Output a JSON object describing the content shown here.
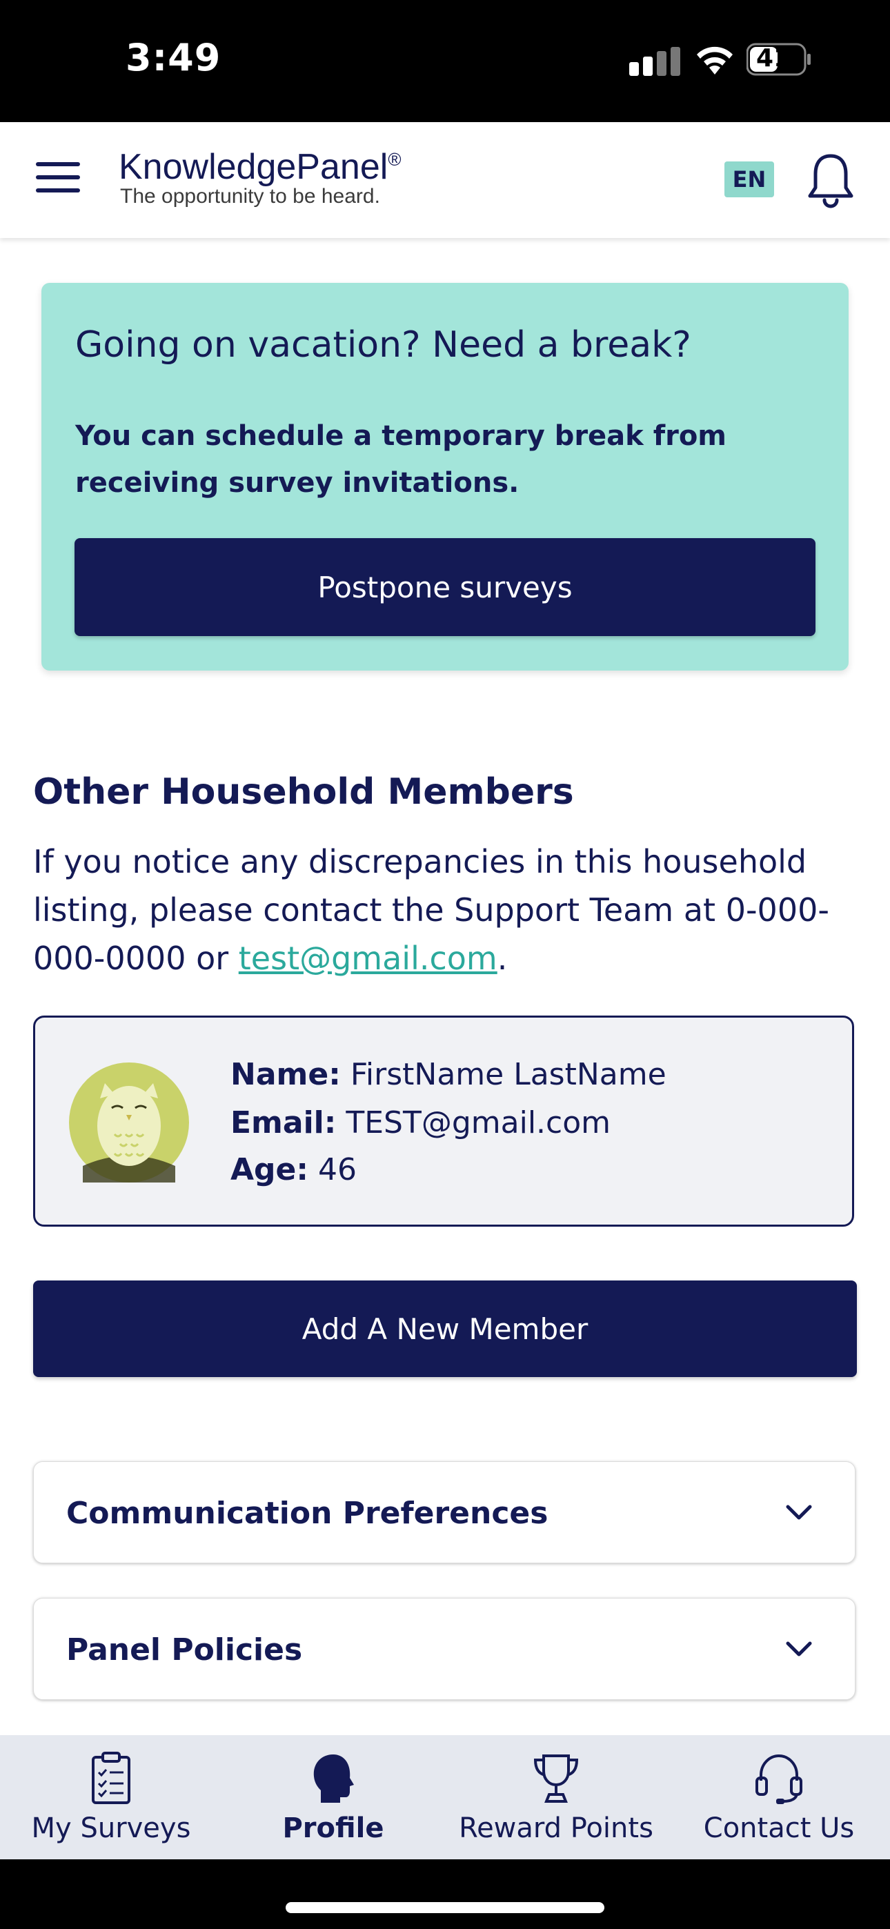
{
  "status_bar": {
    "time": "3:49",
    "battery": "41"
  },
  "header": {
    "brand": "KnowledgePanel",
    "brand_mark": "®",
    "tagline": "The opportunity to be heard.",
    "language": "EN",
    "menu_icon": "hamburger-icon",
    "notification_icon": "bell-icon"
  },
  "vacation_card": {
    "title": "Going on vacation? Need a break?",
    "text": "You can schedule a temporary break from receiving survey invitations.",
    "button": "Postpone surveys"
  },
  "household": {
    "title": "Other Household Members",
    "text_before": "If you notice any discrepancies in this household listing, please contact the Support Team at 0-000-000-0000 or ",
    "email_link": "test@gmail.com",
    "text_after": ".",
    "member": {
      "name_label": "Name:",
      "name": "FirstName LastName",
      "email_label": "Email:",
      "email": "TEST@gmail.com",
      "age_label": "Age:",
      "age": "46",
      "avatar_icon": "owl-avatar-icon"
    },
    "add_button": "Add A New Member"
  },
  "accordions": [
    {
      "label": "Communication Preferences"
    },
    {
      "label": "Panel Policies"
    }
  ],
  "tabs": [
    {
      "label": "My Surveys",
      "icon": "clipboard-icon",
      "active": false
    },
    {
      "label": "Profile",
      "icon": "profile-head-icon",
      "active": true
    },
    {
      "label": "Reward Points",
      "icon": "trophy-icon",
      "active": false
    },
    {
      "label": "Contact Us",
      "icon": "headset-icon",
      "active": false
    }
  ],
  "colors": {
    "navy": "#141a55",
    "teal_card": "#a3e5da",
    "link": "#2ba99c",
    "tabbar": "#e5e8ef"
  }
}
